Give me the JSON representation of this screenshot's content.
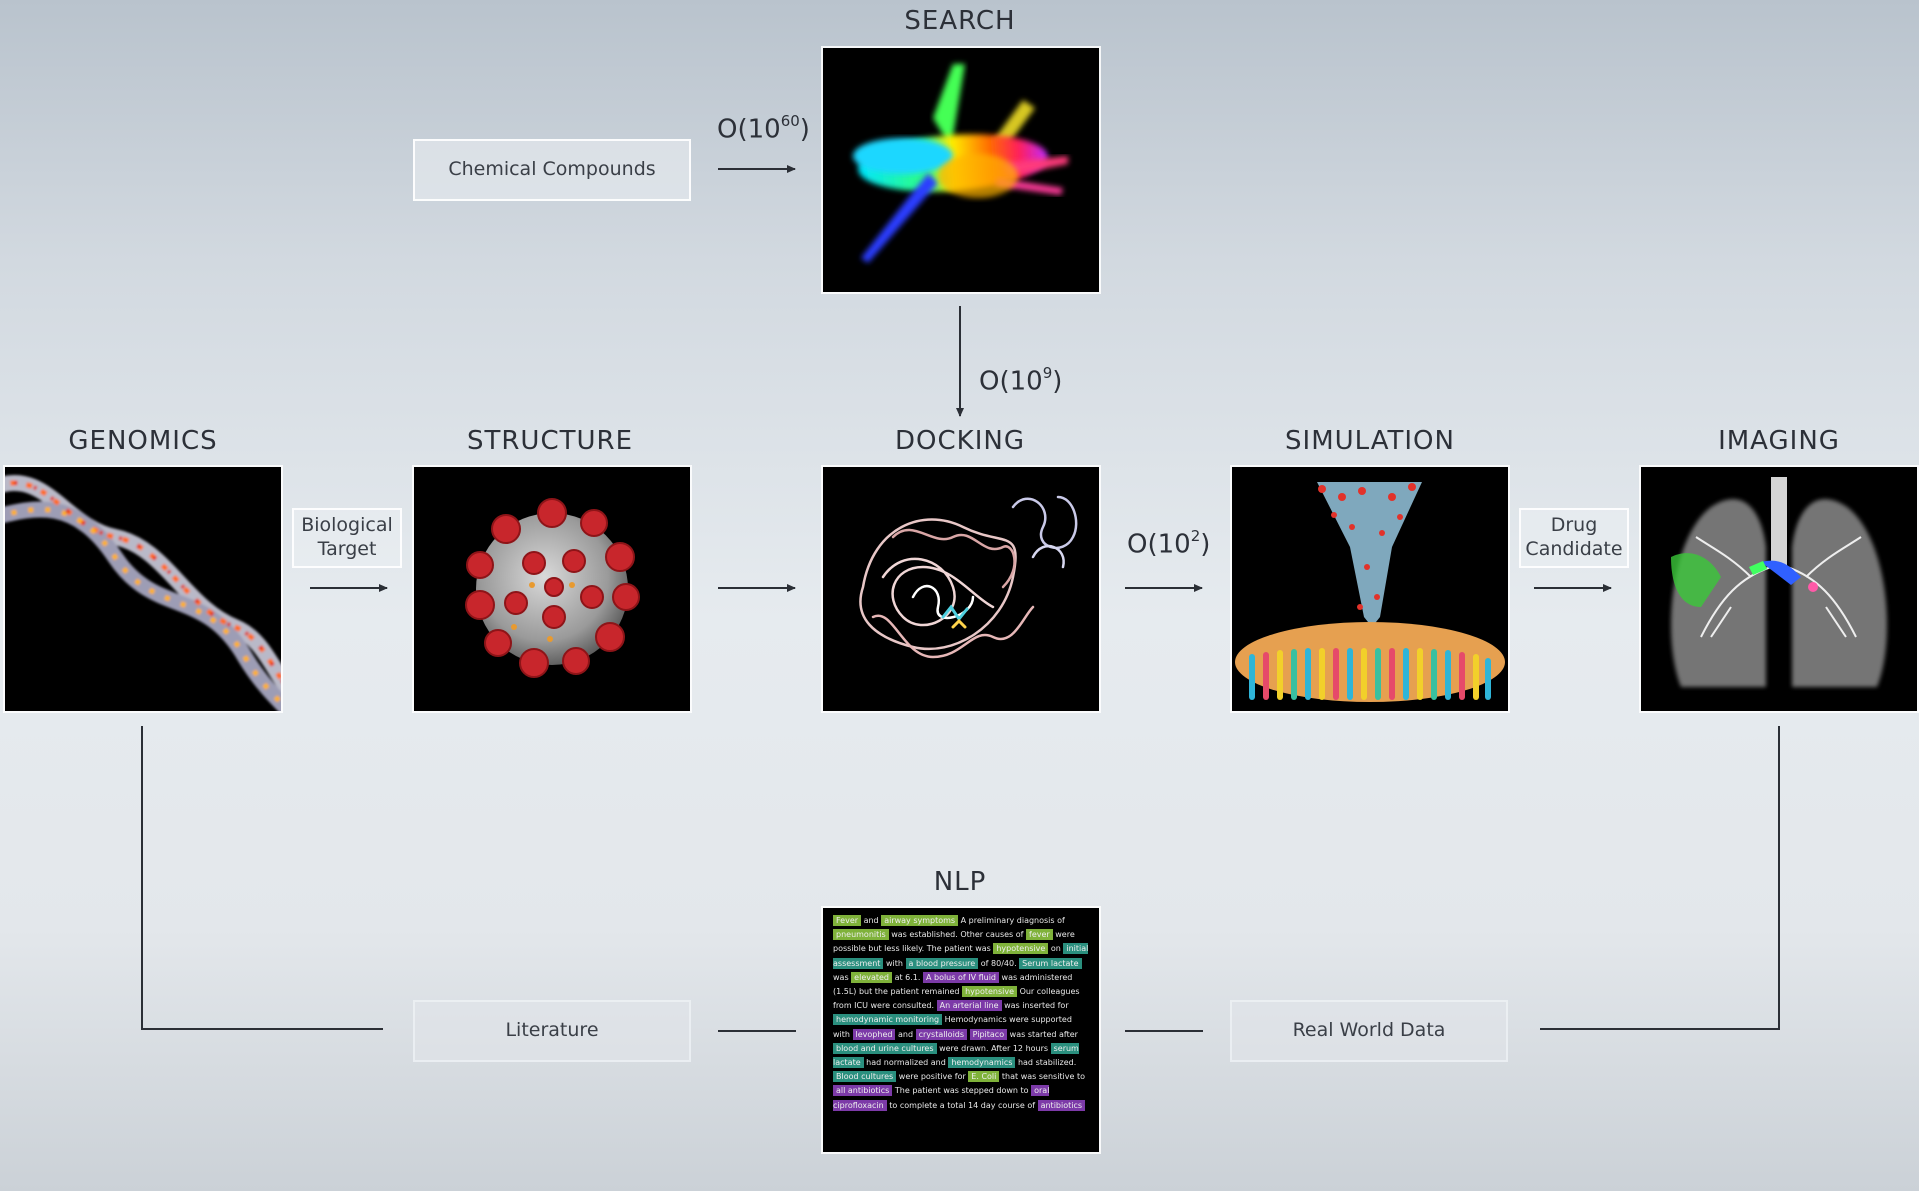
{
  "stages": {
    "search": "SEARCH",
    "genomics": "GENOMICS",
    "structure": "STRUCTURE",
    "docking": "DOCKING",
    "simulation": "SIMULATION",
    "imaging": "IMAGING",
    "nlp": "NLP"
  },
  "labels": {
    "chemical_compounds": "Chemical Compounds",
    "biological_target_1": "Biological",
    "biological_target_2": "Target",
    "drug_candidate_1": "Drug",
    "drug_candidate_2": "Candidate",
    "literature": "Literature",
    "real_world_data": "Real World Data"
  },
  "complexity": {
    "search": {
      "base": "O(10",
      "exp": "60",
      "close": ")"
    },
    "docking": {
      "base": "O(10",
      "exp": "9",
      "close": ")"
    },
    "simulation": {
      "base": "O(10",
      "exp": "2",
      "close": ")"
    }
  },
  "nlp_words": [
    "Fever",
    "and",
    "airway symptoms",
    "A preliminary diagnosis of",
    "pneumonitis",
    "was established. Other causes of",
    "fever",
    "were possible but less likely. The patient was",
    "hypotensive",
    "on",
    "initial assessment",
    "with",
    "a blood pressure",
    "of 80/40.",
    "Serum lactate",
    "was",
    "elevated",
    "at 6.1.",
    "A bolus of IV fluid",
    "was administered (1.5L) but the patient",
    "remained",
    "hypotensive",
    "Our colleagues from ICU were consulted.",
    "An arterial line",
    "was inserted for",
    "hemodynamic monitoring",
    "Hemodynamics were supported with",
    "levophed",
    "and",
    "crystalloids",
    "Pipitaco",
    "was started after",
    "blood and urine cultures",
    "were drawn. After 12 hours",
    "serum lactate",
    "had normalized and",
    "hemodynamics",
    "had",
    "stabilized.",
    "Blood cultures",
    "were positive for",
    "E. Coli",
    "that was sensitive to",
    "all antibiotics",
    "The patient was stepped down to",
    "oral ciprofloxacin",
    "to complete a total 14 day course of",
    "antibiotics"
  ],
  "colors": {
    "panel_bg": "#000000",
    "line": "#2b2f36",
    "tag_green": "#7fb23a",
    "tag_teal": "#2a8f7e",
    "tag_purple": "#7c3aa8"
  }
}
